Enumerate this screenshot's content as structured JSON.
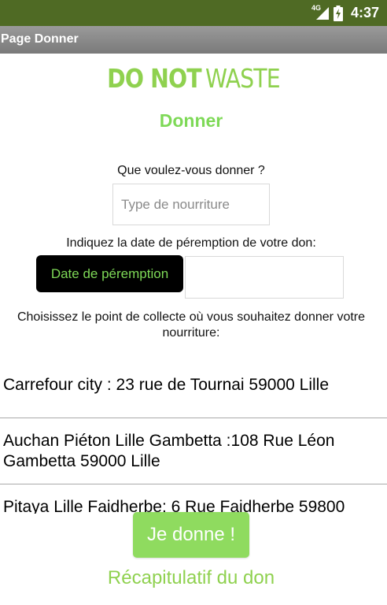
{
  "status_bar": {
    "network": "4G",
    "time": "4:37",
    "icons": [
      "signal-icon",
      "battery-charging-icon"
    ]
  },
  "action_bar": {
    "title": "Page Donner"
  },
  "logo": {
    "bold": "DO NOT",
    "light": "WASTE",
    "color": "#8fd14f"
  },
  "form": {
    "title": "Donner",
    "food_question": "Que voulez-vous donner ?",
    "food_placeholder": "Type de nourriture",
    "date_question": "Indiquez la date de péremption de votre don:",
    "date_button_label": "Date de péremption",
    "date_value": "",
    "collect_question": "Choisissez le point de collecte où vous souhaitez donner votre nourriture:",
    "collect_points": [
      "Carrefour city : 23 rue de Tournai 59000 Lille",
      "Auchan Piéton Lille Gambetta :108 Rue Léon Gambetta 59000 Lille",
      "Pitaya Lille Faidherbe: 6 Rue Faidherbe 59800"
    ],
    "submit_label": "Je donne !",
    "summary_label": "Récapitulatif du don"
  },
  "colors": {
    "status_bar": "#4f6a24",
    "accent_green": "#7ed957",
    "button_green": "#8fdb5f",
    "date_button_bg": "#000000"
  }
}
